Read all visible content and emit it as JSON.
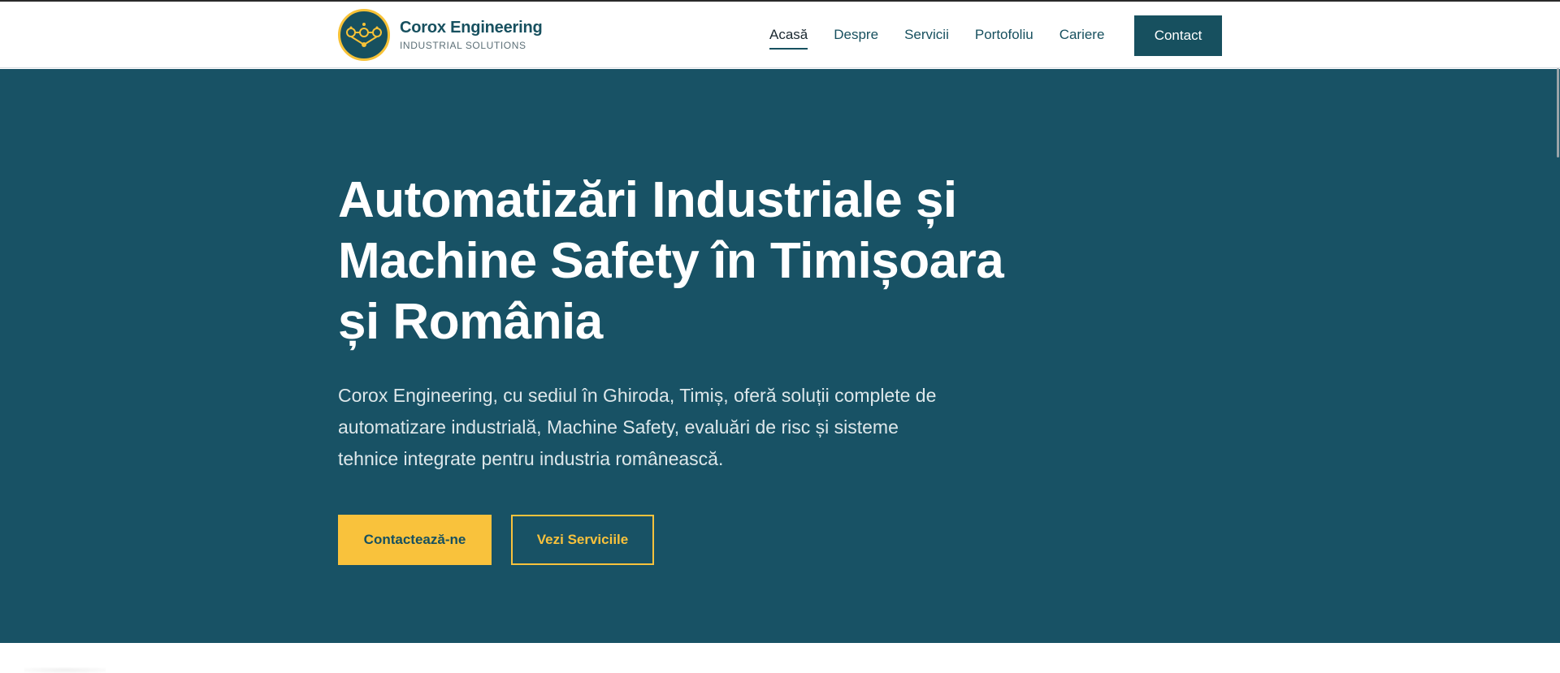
{
  "header": {
    "brand_name": "Corox Engineering",
    "brand_tagline": "INDUSTRIAL SOLUTIONS",
    "logo_icon": "gears-network-icon",
    "nav": [
      {
        "label": "Acasă",
        "active": true
      },
      {
        "label": "Despre",
        "active": false
      },
      {
        "label": "Servicii",
        "active": false
      },
      {
        "label": "Portofoliu",
        "active": false
      },
      {
        "label": "Cariere",
        "active": false
      }
    ],
    "contact_label": "Contact"
  },
  "hero": {
    "title": "Automatizări Industriale și Machine Safety în Timișoara și România",
    "description": "Corox Engineering, cu sediul în Ghiroda, Timiș, oferă soluții complete de automatizare industrială, Machine Safety, evaluări de risc și sisteme tehnice integrate pentru industria românească.",
    "primary_button": "Contactează-ne",
    "secondary_button": "Vezi Serviciile"
  },
  "colors": {
    "primary": "#185265",
    "accent": "#f9c23c",
    "background": "#ffffff"
  }
}
